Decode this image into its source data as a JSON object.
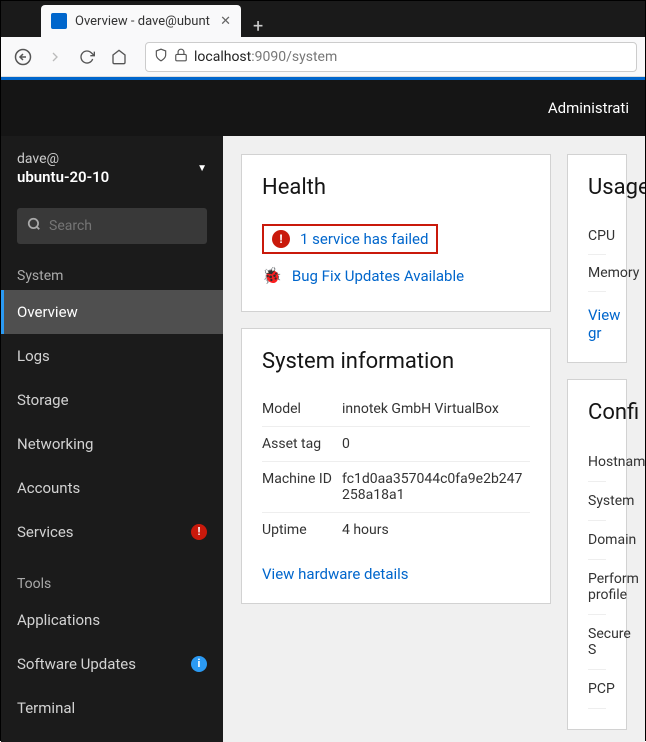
{
  "browser": {
    "tab_title": "Overview - dave@ubunt",
    "url_host": "localhost",
    "url_port_path": ":9090/system"
  },
  "header": {
    "right_text": "Administrati"
  },
  "host": {
    "user": "dave@",
    "name": "ubuntu-20-10"
  },
  "search": {
    "placeholder": "Search"
  },
  "sidebar": {
    "section1": "System",
    "section2": "Tools",
    "items": [
      {
        "label": "Overview"
      },
      {
        "label": "Logs"
      },
      {
        "label": "Storage"
      },
      {
        "label": "Networking"
      },
      {
        "label": "Accounts"
      },
      {
        "label": "Services"
      }
    ],
    "tools": [
      {
        "label": "Applications"
      },
      {
        "label": "Software Updates"
      },
      {
        "label": "Terminal"
      }
    ]
  },
  "health": {
    "title": "Health",
    "failed": "1 service has failed",
    "updates": "Bug Fix Updates Available"
  },
  "sysinfo": {
    "title": "System information",
    "rows": [
      {
        "label": "Model",
        "value": "innotek GmbH VirtualBox"
      },
      {
        "label": "Asset tag",
        "value": "0"
      },
      {
        "label": "Machine ID",
        "value": "fc1d0aa357044c0fa9e2b247258a18a1"
      },
      {
        "label": "Uptime",
        "value": "4 hours"
      }
    ],
    "link": "View hardware details"
  },
  "usage": {
    "title": "Usage",
    "cpu": "CPU",
    "memory": "Memory",
    "link": "View gr"
  },
  "config": {
    "title": "Confi",
    "rows": [
      "Hostnam",
      "System",
      "Domain",
      "Perform profile",
      "Secure S",
      "PCP"
    ]
  }
}
